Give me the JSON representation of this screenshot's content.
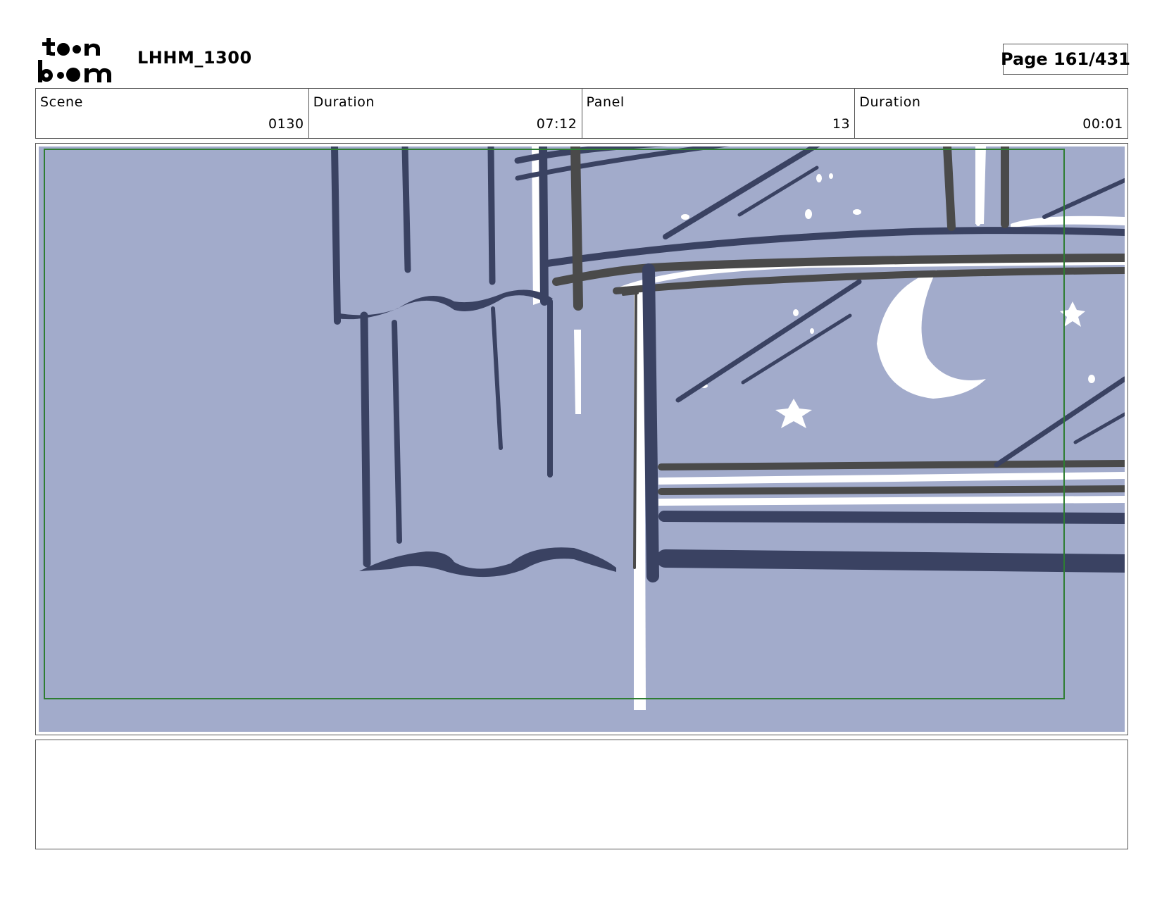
{
  "header": {
    "logo_text": "toonboom",
    "project_title": "LHHM_1300",
    "page_label": "Page 161/431"
  },
  "info": {
    "scene_label": "Scene",
    "scene_value": "0130",
    "scene_duration_label": "Duration",
    "scene_duration_value": "07:12",
    "panel_label": "Panel",
    "panel_value": "13",
    "panel_duration_label": "Duration",
    "panel_duration_value": "00:01"
  },
  "panel": {
    "background_color": "#a2abcb",
    "line_color": "#3a4262",
    "highlight_color": "#ffffff",
    "safe_frame_color": "#2e7d32"
  },
  "notes": {
    "text": ""
  }
}
